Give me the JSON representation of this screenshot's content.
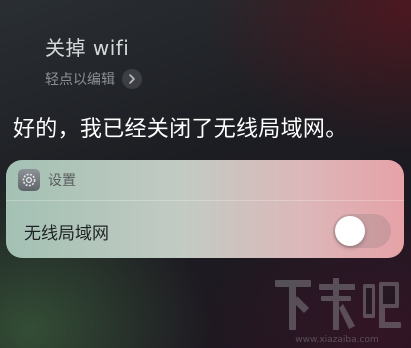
{
  "siri": {
    "query": "关掉 wifi",
    "edit_hint": "轻点以编辑",
    "reply": "好的，我已经关闭了无线局域网。"
  },
  "card": {
    "app_name": "设置",
    "setting_label": "无线局域网",
    "toggle_on": false
  },
  "watermark": {
    "brand": "下载吧",
    "url": "www.xiazaiba.com"
  },
  "colors": {
    "card_left": "#a3c1b4",
    "card_right": "#e6a2a7"
  }
}
